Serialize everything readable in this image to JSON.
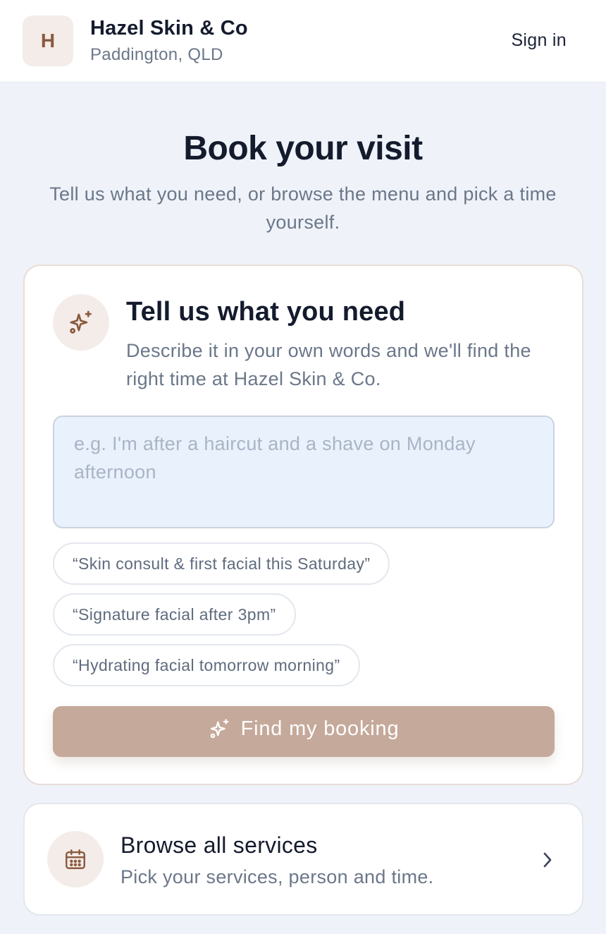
{
  "header": {
    "logo_letter": "H",
    "business_name": "Hazel Skin & Co",
    "location": "Paddington, QLD",
    "sign_in_label": "Sign in"
  },
  "intro": {
    "title": "Book your visit",
    "subtitle": "Tell us what you need, or browse the menu and pick a time yourself."
  },
  "assistant_card": {
    "icon": "sparkles-icon",
    "title": "Tell us what you need",
    "description": "Describe it in your own words and we'll find the right time at Hazel Skin & Co.",
    "input_value": "",
    "input_placeholder": "e.g. I'm after a haircut and a shave on Monday afternoon",
    "suggestions": [
      "“Skin consult & first facial this Saturday”",
      "“Signature facial after 3pm”",
      "“Hydrating facial tomorrow morning”"
    ],
    "find_button_label": "Find my booking"
  },
  "browse": {
    "icon": "calendar-icon",
    "title": "Browse all services",
    "subtitle": "Pick your services, person and time."
  },
  "colors": {
    "accent": "#8a5a3f",
    "accent_soft": "#f4ece8",
    "button_disabled": "#c5a99a",
    "background": "#eff3f9"
  }
}
